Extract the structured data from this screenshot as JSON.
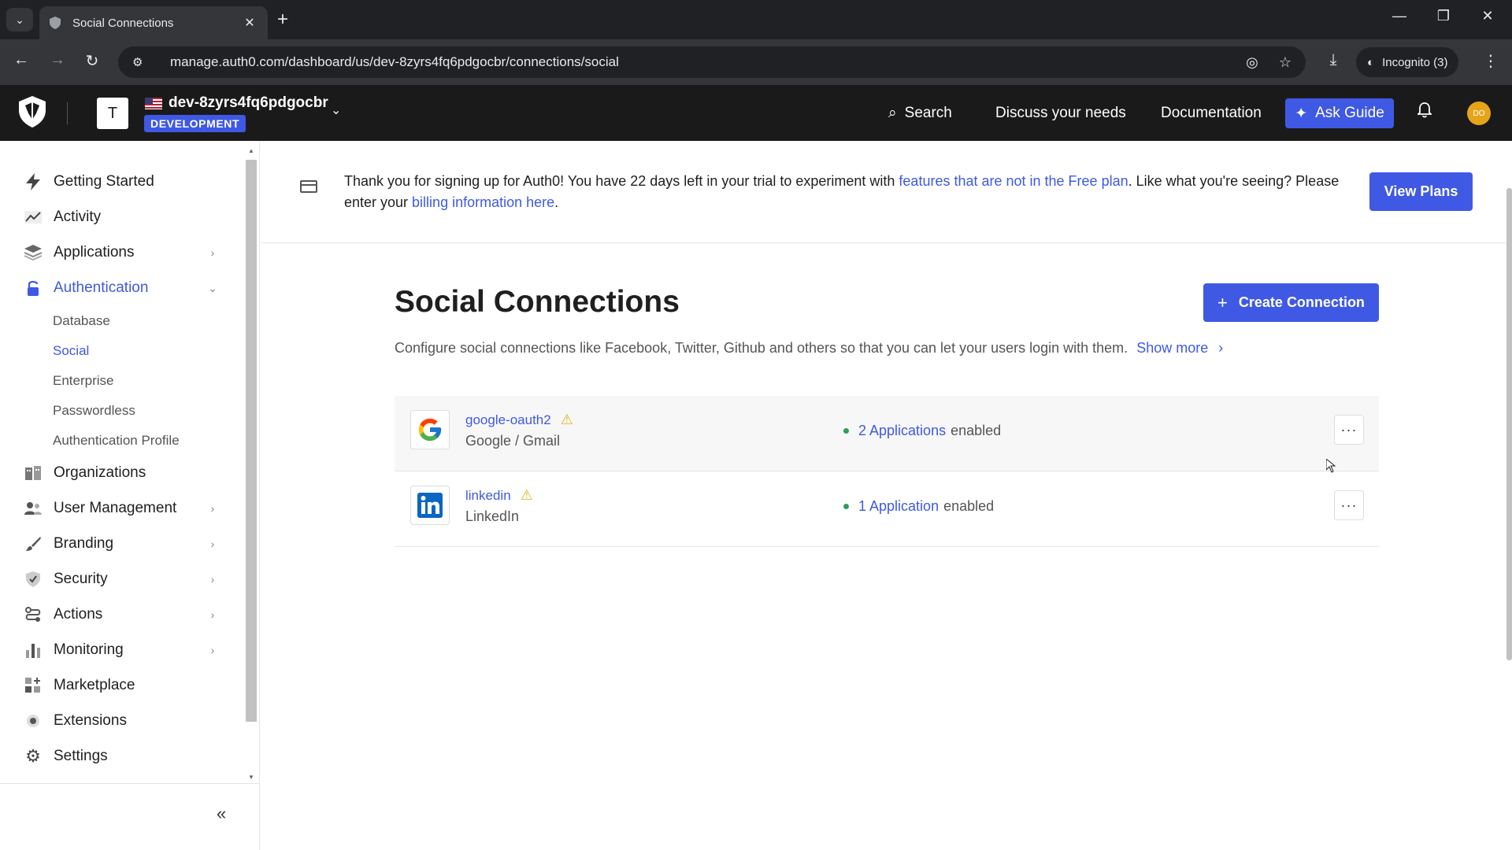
{
  "browser": {
    "tab_title": "Social Connections",
    "url": "manage.auth0.com/dashboard/us/dev-8zyrs4fq6pdgocbr/connections/social",
    "incognito_label": "Incognito (3)"
  },
  "header": {
    "tenant_initial": "T",
    "tenant_name": "dev-8zyrs4fq6pdgocbr",
    "env_badge": "DEVELOPMENT",
    "search_label": "Search",
    "discuss_label": "Discuss your needs",
    "docs_label": "Documentation",
    "ask_guide_label": "Ask Guide",
    "user_initials": "DO"
  },
  "sidebar": {
    "items": [
      {
        "label": "Getting Started",
        "icon": "bolt-icon"
      },
      {
        "label": "Activity",
        "icon": "activity-icon"
      },
      {
        "label": "Applications",
        "icon": "layers-icon"
      },
      {
        "label": "Authentication",
        "icon": "lock-icon"
      },
      {
        "label": "Organizations",
        "icon": "building-icon"
      },
      {
        "label": "User Management",
        "icon": "users-icon"
      },
      {
        "label": "Branding",
        "icon": "brush-icon"
      },
      {
        "label": "Security",
        "icon": "shield-check-icon"
      },
      {
        "label": "Actions",
        "icon": "actions-icon"
      },
      {
        "label": "Monitoring",
        "icon": "bar-chart-icon"
      },
      {
        "label": "Marketplace",
        "icon": "marketplace-icon"
      },
      {
        "label": "Extensions",
        "icon": "extensions-icon"
      },
      {
        "label": "Settings",
        "icon": "gear-icon"
      }
    ],
    "auth_sub": [
      "Database",
      "Social",
      "Enterprise",
      "Passwordless",
      "Authentication Profile"
    ]
  },
  "banner": {
    "text_1": "Thank you for signing up for Auth0! You have 22 days left in your trial to experiment with ",
    "link_1": "features that are not in the Free plan",
    "text_2": ". Like what you're seeing? Please enter your ",
    "link_2": "billing information here",
    "text_3": ".",
    "button": "View Plans"
  },
  "page": {
    "title": "Social Connections",
    "create_button": "Create Connection",
    "description": "Configure social connections like Facebook, Twitter, Github and others so that you can let your users login with them.",
    "show_more": "Show more"
  },
  "connections": [
    {
      "name": "google-oauth2",
      "type": "Google / Gmail",
      "apps_count": "2 Applications",
      "apps_suffix": "enabled"
    },
    {
      "name": "linkedin",
      "type": "LinkedIn",
      "apps_count": "1 Application",
      "apps_suffix": "enabled"
    }
  ],
  "colors": {
    "accent": "#3f59e4",
    "header_bg": "#1a1a1a",
    "warn": "#e0b31c",
    "status_ok": "#2e9e5b"
  }
}
